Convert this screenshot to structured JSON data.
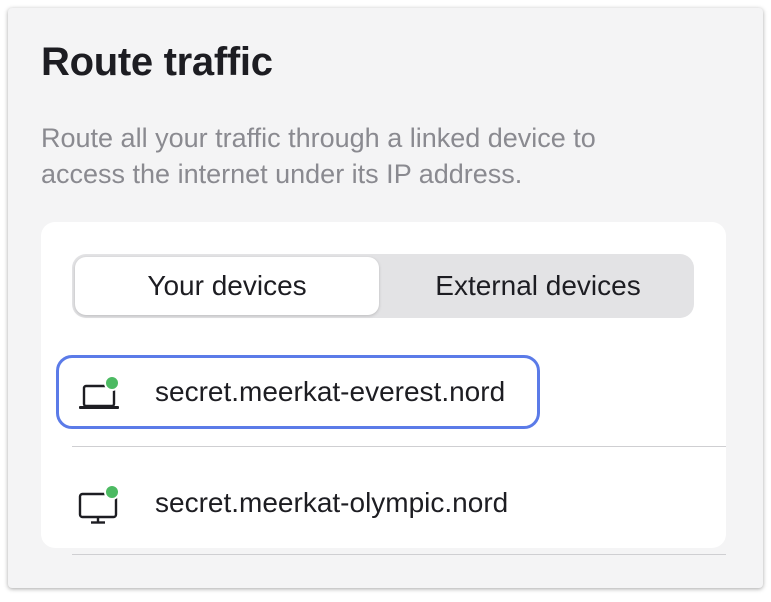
{
  "header": {
    "title": "Route traffic",
    "description": "Route all your traffic through a linked device to access the internet under its IP address."
  },
  "tabs": [
    {
      "label": "Your devices",
      "selected": true
    },
    {
      "label": "External devices",
      "selected": false
    }
  ],
  "devices": [
    {
      "name": "secret.meerkat-everest.nord",
      "icon": "laptop-icon",
      "status": "online",
      "focused": true
    },
    {
      "name": "secret.meerkat-olympic.nord",
      "icon": "desktop-icon",
      "status": "online",
      "focused": false
    }
  ],
  "colors": {
    "focus_ring": "#5b7be8",
    "online_dot": "#4cba62"
  }
}
